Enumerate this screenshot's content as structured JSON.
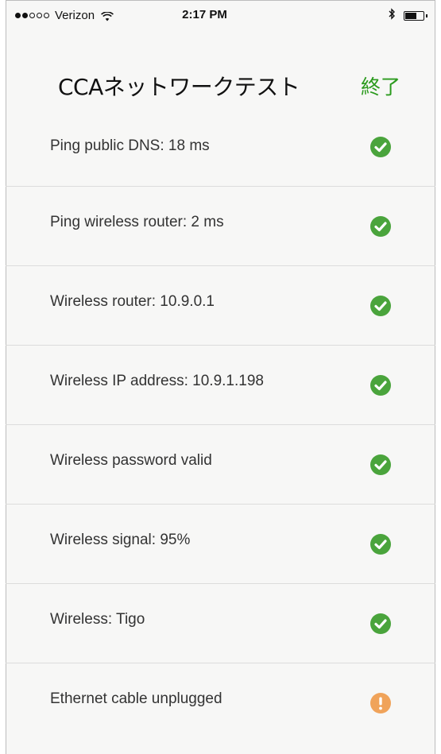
{
  "status_bar": {
    "carrier": "Verizon",
    "time": "2:17 PM",
    "signal_bars_filled": 2,
    "signal_bars_total": 5
  },
  "nav": {
    "title": "CCAネットワークテスト",
    "done_label": "終了"
  },
  "results": [
    {
      "label": "Ping public DNS: 18 ms",
      "status": "ok",
      "icon": "check-circle-icon"
    },
    {
      "label": "Ping wireless router: 2 ms",
      "status": "ok",
      "icon": "check-circle-icon"
    },
    {
      "label": "Wireless router: 10.9.0.1",
      "status": "ok",
      "icon": "check-circle-icon"
    },
    {
      "label": "Wireless IP address: 10.9.1.198",
      "status": "ok",
      "icon": "check-circle-icon"
    },
    {
      "label": "Wireless password valid",
      "status": "ok",
      "icon": "check-circle-icon"
    },
    {
      "label": "Wireless signal: 95%",
      "status": "ok",
      "icon": "check-circle-icon"
    },
    {
      "label": "Wireless: Tigo",
      "status": "ok",
      "icon": "check-circle-icon"
    },
    {
      "label": "Ethernet cable unplugged",
      "status": "warning",
      "icon": "warning-icon"
    }
  ],
  "colors": {
    "ok": "#4aa43c",
    "warning": "#f0a35a",
    "accent": "#2a9a1c"
  }
}
